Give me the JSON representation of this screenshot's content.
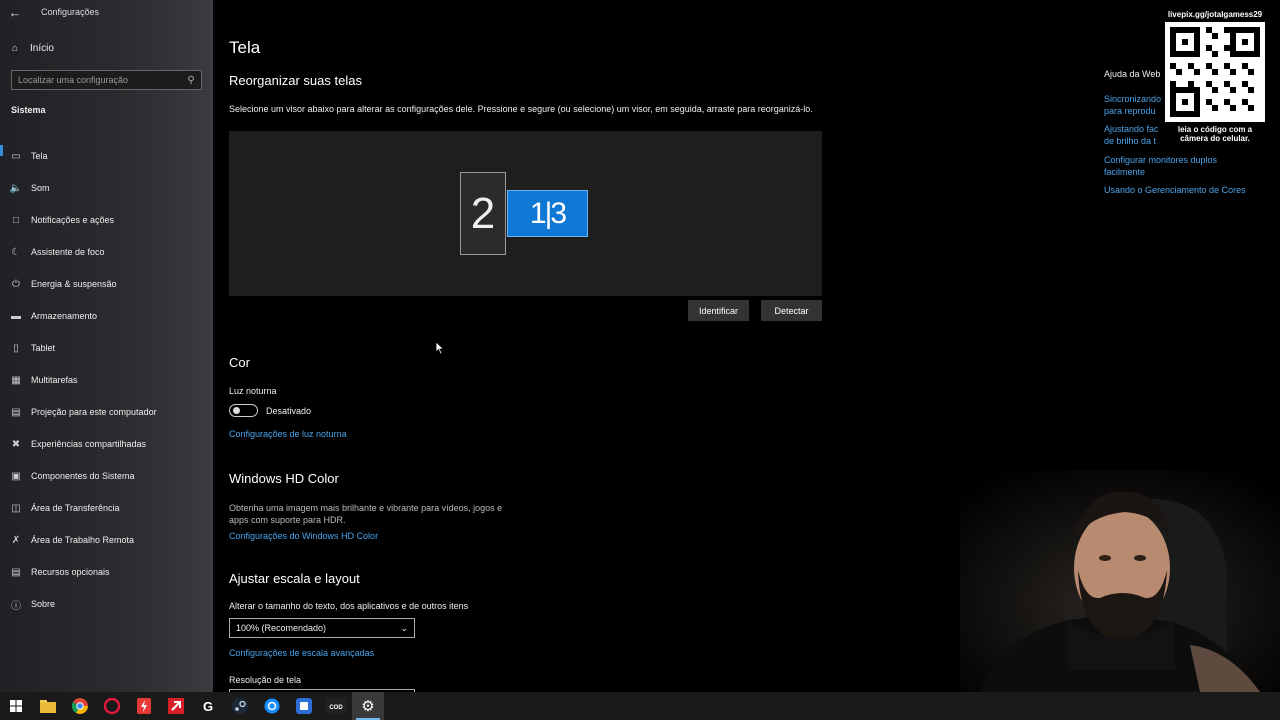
{
  "window": {
    "app_title": "Configurações"
  },
  "sidebar": {
    "home_label": "Início",
    "search_placeholder": "Localizar uma configuração",
    "section": "Sistema",
    "items": [
      {
        "label": "Tela",
        "icon": "monitor-icon"
      },
      {
        "label": "Som",
        "icon": "speaker-icon"
      },
      {
        "label": "Notificações e ações",
        "icon": "notification-icon"
      },
      {
        "label": "Assistente de foco",
        "icon": "moon-icon"
      },
      {
        "label": "Energia & suspensão",
        "icon": "power-icon"
      },
      {
        "label": "Armazenamento",
        "icon": "storage-icon"
      },
      {
        "label": "Tablet",
        "icon": "tablet-icon"
      },
      {
        "label": "Multitarefas",
        "icon": "multitask-icon"
      },
      {
        "label": "Projeção para este computador",
        "icon": "projection-icon"
      },
      {
        "label": "Experiências compartilhadas",
        "icon": "shared-icon"
      },
      {
        "label": "Componentes do Sistema",
        "icon": "components-icon"
      },
      {
        "label": "Área de Transferência",
        "icon": "clipboard-icon"
      },
      {
        "label": "Área de Trabalho Remota",
        "icon": "remote-icon"
      },
      {
        "label": "Recursos opcionais",
        "icon": "features-icon"
      },
      {
        "label": "Sobre",
        "icon": "info-icon"
      }
    ]
  },
  "main": {
    "title": "Tela",
    "arrange": {
      "heading": "Reorganizar suas telas",
      "description": "Selecione um visor abaixo para alterar as configurações dele. Pressione e segure (ou selecione) um visor, em seguida, arraste para reorganizá-lo.",
      "monitor_2_label": "2",
      "monitor_1_label": "1|3",
      "identify_button": "Identificar",
      "detect_button": "Detectar"
    },
    "color": {
      "heading": "Cor",
      "night_light_label": "Luz noturna",
      "night_light_state": "Desativado",
      "night_light_link": "Configurações de luz noturna"
    },
    "hdr": {
      "heading": "Windows HD Color",
      "description_line1": "Obtenha uma imagem mais brilhante e vibrante para vídeos, jogos e",
      "description_line2": "apps com suporte para HDR.",
      "link": "Configurações do Windows HD Color"
    },
    "scale": {
      "heading": "Ajustar escala e layout",
      "size_label": "Alterar o tamanho do texto, dos aplicativos e de outros itens",
      "size_value": "100% (Recomendado)",
      "advanced_link": "Configurações de escala avançadas",
      "resolution_label": "Resolução de tela"
    }
  },
  "help": {
    "title": "Ajuda da Web",
    "links": [
      {
        "line1": "Sincronizando",
        "line2": "para reprodu"
      },
      {
        "line1": "Ajustando fac",
        "line2": "de brilho da t"
      },
      {
        "line1": "Configurar monitores duplos",
        "line2": "facilmente"
      },
      {
        "line1": "Usando o Gerenciamento de Cores",
        "line2": ""
      }
    ]
  },
  "overlay": {
    "url": "livepix.gg/jotalgamess29",
    "caption_line1": "leia o código com a",
    "caption_line2": "câmera do celular."
  },
  "taskbar": {
    "apps": [
      "windows-start-icon",
      "file-explorer-icon",
      "chrome-icon",
      "opera-icon",
      "power-app-icon",
      "amd-icon",
      "logitech-icon",
      "steam-icon",
      "battlenet-icon",
      "app-blue-icon",
      "call-of-duty-icon",
      "settings-icon"
    ]
  },
  "colors": {
    "accent": "#0f78d4",
    "link": "#4aa3ea",
    "background": "#000000"
  }
}
